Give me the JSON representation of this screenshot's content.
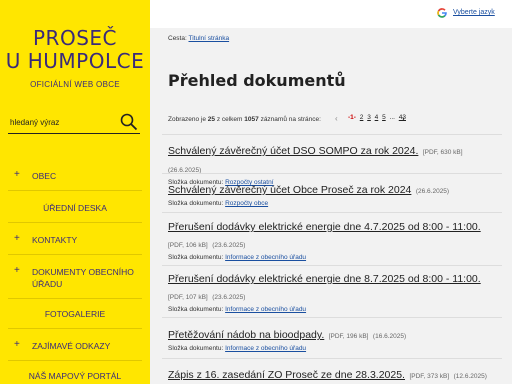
{
  "sidebar": {
    "title_line1": "PROSEČ",
    "title_line2": "U HUMPOLCE",
    "subtitle": "OFICIÁLNÍ WEB OBCE",
    "search_placeholder": "hledaný výraz",
    "nav": [
      {
        "label": "OBEC",
        "expandable": true
      },
      {
        "label": "ÚŘEDNÍ DESKA",
        "expandable": false
      },
      {
        "label": "KONTAKTY",
        "expandable": true
      },
      {
        "label": "DOKUMENTY OBECNÍHO",
        "label2": "ÚŘADU",
        "expandable": true
      },
      {
        "label": "FOTOGALERIE",
        "expandable": false
      },
      {
        "label": "ZAJÍMAVÉ ODKAZY",
        "expandable": true
      },
      {
        "label": "NÁŠ MAPOVÝ PORTÁL",
        "expandable": false
      }
    ]
  },
  "topbar": {
    "language_link": "Vyberte jazyk",
    "google_icon": "google-g-icon"
  },
  "breadcrumb": {
    "prefix": "Cesta:",
    "link": "Titulní stránka"
  },
  "page_title": "Přehled dokumentů",
  "pager": {
    "info_prefix": "Zobrazeno je",
    "shown": "25",
    "info_mid": "z celkem",
    "total": "1057",
    "info_suffix": "záznamů na stránce:",
    "current": "-1-",
    "pages": [
      "2",
      "3",
      "4",
      "5",
      "...",
      "43"
    ]
  },
  "documents": [
    {
      "title": "Schválený závěrečný účet DSO SOMPO za rok 2024.",
      "meta": "[PDF, 630 kB]",
      "date": "(26.6.2025)",
      "folder_label": "Složka dokumentu:",
      "folder": "Rozpočty ostatní"
    },
    {
      "title": "Schválený závěrečný účet Obce Proseč za rok 2024",
      "meta": "",
      "date": "(26.6.2025)",
      "folder_label": "Složka dokumentu:",
      "folder": "Rozpočty obce"
    },
    {
      "title": "Přerušení dodávky elektrické energie dne 4.7.2025 od 8:00 - 11:00.",
      "meta": "[PDF, 106 kB]",
      "date": "(23.6.2025)",
      "folder_label": "Složka dokumentu:",
      "folder": "Informace z obecního úřadu"
    },
    {
      "title": "Přerušení dodávky elektrické energie dne 8.7.2025 od 8:00 - 11:00.",
      "meta": "[PDF, 107 kB]",
      "date": "(23.6.2025)",
      "folder_label": "Složka dokumentu:",
      "folder": "Informace z obecního úřadu"
    },
    {
      "title": "Přetěžování nádob na bioodpady.",
      "meta": "[PDF, 196 kB]",
      "date": "(16.6.2025)",
      "folder_label": "Složka dokumentu:",
      "folder": "Informace z obecního úřadu"
    },
    {
      "title": "Zápis z 16. zasedání ZO Proseč ze dne 28.3.2025.",
      "meta": "[PDF, 373 kB]",
      "date": "(12.6.2025)",
      "folder_label": "",
      "folder": ""
    }
  ]
}
